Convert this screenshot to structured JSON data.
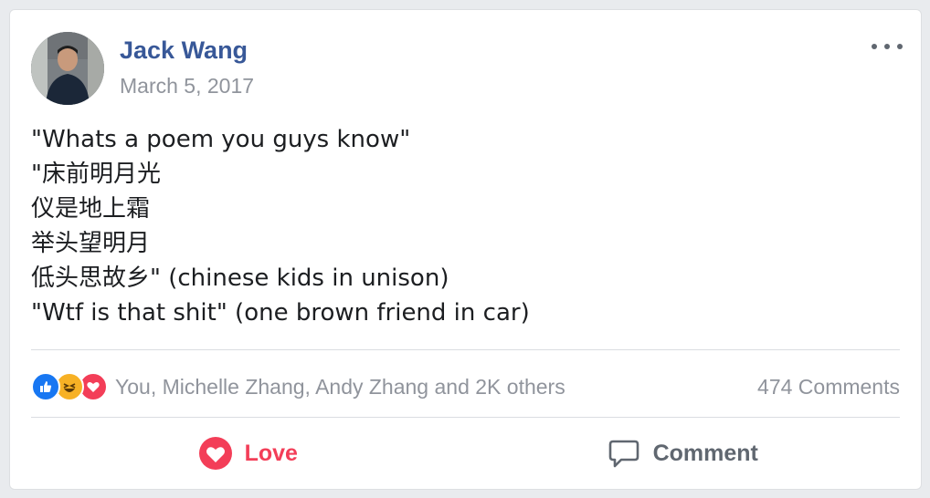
{
  "post": {
    "author": "Jack Wang",
    "date": "March 5, 2017",
    "lines": [
      "\"Whats a poem you guys know\"",
      "\"床前明月光",
      "仪是地上霜",
      "举头望明月",
      "低头思故乡\" (chinese kids in unison)",
      "\"Wtf is that shit\" (one brown friend in car)"
    ]
  },
  "reactions": {
    "icons": [
      "like-icon",
      "haha-icon",
      "love-icon"
    ],
    "summary": "You, Michelle Zhang, Andy Zhang and 2K others",
    "comments": "474 Comments"
  },
  "actions": {
    "love_label": "Love",
    "comment_label": "Comment"
  },
  "colors": {
    "name_link": "#385898",
    "meta_gray": "#90949c",
    "love_red": "#f33e58",
    "like_blue": "#1877f2",
    "haha_yellow": "#f7b125"
  }
}
